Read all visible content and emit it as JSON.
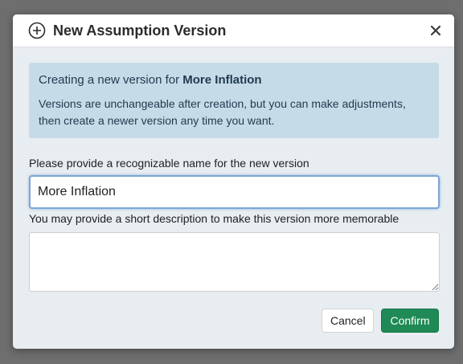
{
  "dialog": {
    "title": "New Assumption Version",
    "icons": {
      "title_icon": "plus-circle-icon",
      "close_icon": "close-icon"
    }
  },
  "info": {
    "intro_text": "Creating a new version for",
    "target_name": "More Inflation",
    "description": "Versions are unchangeable after creation, but you can make adjustments, then create a newer version any time you want."
  },
  "form": {
    "name_label": "Please provide a recognizable name for the new version",
    "name_value": "More Inflation",
    "description_label": "You may provide a short description to make this version more memorable",
    "description_value": ""
  },
  "actions": {
    "cancel_label": "Cancel",
    "confirm_label": "Confirm"
  },
  "colors": {
    "overlay": "#6e6e6e",
    "dialog_bg": "#e7edf1",
    "info_bg": "#c6dbe8",
    "confirm_bg": "#1f8a55",
    "focus_border": "#7aa7d3"
  }
}
